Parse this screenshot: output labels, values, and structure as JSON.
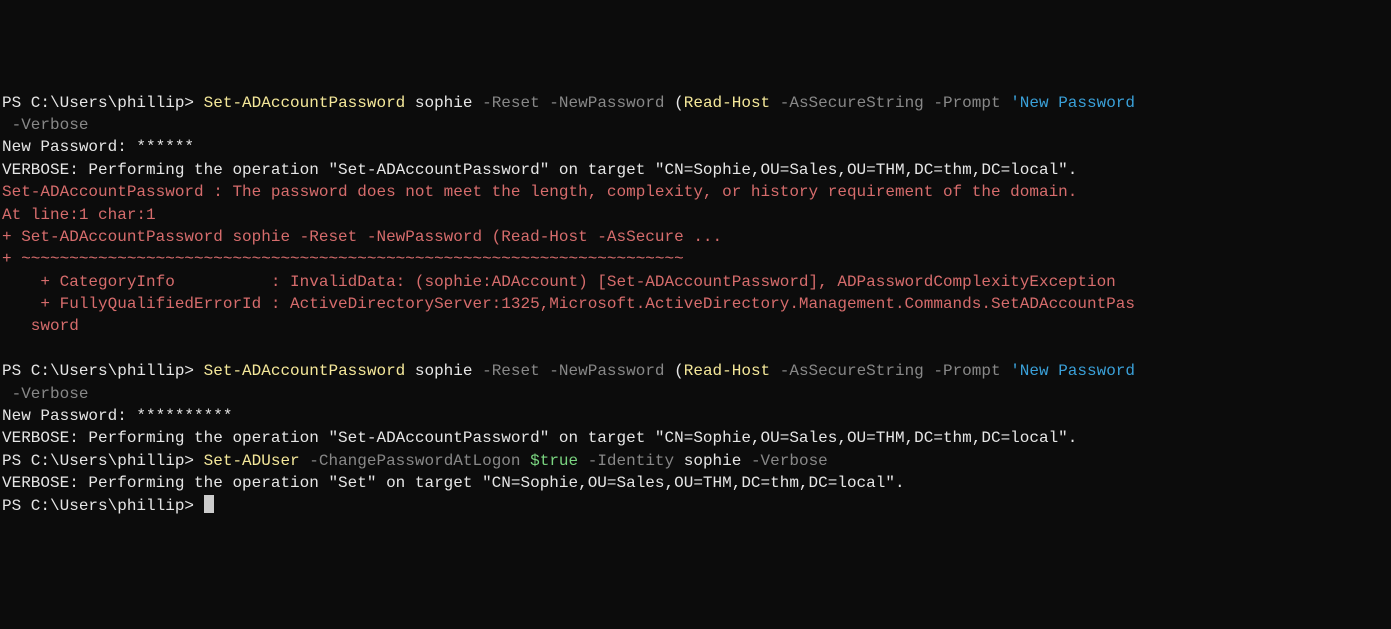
{
  "terminal": {
    "lines": [
      {
        "segments": [
          {
            "cls": "c-white",
            "text": "PS C:\\Users\\phillip> "
          },
          {
            "cls": "c-yellow",
            "text": "Set-ADAccountPassword "
          },
          {
            "cls": "c-white",
            "text": "sophie "
          },
          {
            "cls": "c-gray",
            "text": "-Reset -NewPassword "
          },
          {
            "cls": "c-white",
            "text": "("
          },
          {
            "cls": "c-yellow",
            "text": "Read-Host "
          },
          {
            "cls": "c-gray",
            "text": "-AsSecureString -Prompt "
          },
          {
            "cls": "c-cyan",
            "text": "'New Password"
          }
        ]
      },
      {
        "segments": [
          {
            "cls": "c-gray",
            "text": " -Verbose"
          }
        ]
      },
      {
        "segments": [
          {
            "cls": "c-white",
            "text": "New Password: ******"
          }
        ]
      },
      {
        "segments": [
          {
            "cls": "c-white",
            "text": "VERBOSE: Performing the operation \"Set-ADAccountPassword\" on target \"CN=Sophie,OU=Sales,OU=THM,DC=thm,DC=local\"."
          }
        ]
      },
      {
        "segments": [
          {
            "cls": "c-red",
            "text": "Set-ADAccountPassword : The password does not meet the length, complexity, or history requirement of the domain."
          }
        ]
      },
      {
        "segments": [
          {
            "cls": "c-red",
            "text": "At line:1 char:1"
          }
        ]
      },
      {
        "segments": [
          {
            "cls": "c-red",
            "text": "+ Set-ADAccountPassword sophie -Reset -NewPassword (Read-Host -AsSecure ..."
          }
        ]
      },
      {
        "segments": [
          {
            "cls": "c-red",
            "text": "+ ~~~~~~~~~~~~~~~~~~~~~~~~~~~~~~~~~~~~~~~~~~~~~~~~~~~~~~~~~~~~~~~~~~~~~"
          }
        ]
      },
      {
        "segments": [
          {
            "cls": "c-red",
            "text": "    + CategoryInfo          : InvalidData: (sophie:ADAccount) [Set-ADAccountPassword], ADPasswordComplexityException"
          }
        ]
      },
      {
        "segments": [
          {
            "cls": "c-red",
            "text": "    + FullyQualifiedErrorId : ActiveDirectoryServer:1325,Microsoft.ActiveDirectory.Management.Commands.SetADAccountPas"
          }
        ]
      },
      {
        "segments": [
          {
            "cls": "c-red",
            "text": "   sword"
          }
        ]
      },
      {
        "segments": [
          {
            "cls": "",
            "text": " "
          }
        ]
      },
      {
        "segments": [
          {
            "cls": "c-white",
            "text": "PS C:\\Users\\phillip> "
          },
          {
            "cls": "c-yellow",
            "text": "Set-ADAccountPassword "
          },
          {
            "cls": "c-white",
            "text": "sophie "
          },
          {
            "cls": "c-gray",
            "text": "-Reset -NewPassword "
          },
          {
            "cls": "c-white",
            "text": "("
          },
          {
            "cls": "c-yellow",
            "text": "Read-Host "
          },
          {
            "cls": "c-gray",
            "text": "-AsSecureString -Prompt "
          },
          {
            "cls": "c-cyan",
            "text": "'New Password"
          }
        ]
      },
      {
        "segments": [
          {
            "cls": "c-gray",
            "text": " -Verbose"
          }
        ]
      },
      {
        "segments": [
          {
            "cls": "c-white",
            "text": "New Password: **********"
          }
        ]
      },
      {
        "segments": [
          {
            "cls": "c-white",
            "text": "VERBOSE: Performing the operation \"Set-ADAccountPassword\" on target \"CN=Sophie,OU=Sales,OU=THM,DC=thm,DC=local\"."
          }
        ]
      },
      {
        "segments": [
          {
            "cls": "c-white",
            "text": "PS C:\\Users\\phillip> "
          },
          {
            "cls": "c-yellow",
            "text": "Set-ADUser "
          },
          {
            "cls": "c-gray",
            "text": "-ChangePasswordAtLogon "
          },
          {
            "cls": "c-green",
            "text": "$true "
          },
          {
            "cls": "c-gray",
            "text": "-Identity "
          },
          {
            "cls": "c-white",
            "text": "sophie "
          },
          {
            "cls": "c-gray",
            "text": "-Verbose"
          }
        ]
      },
      {
        "segments": [
          {
            "cls": "c-white",
            "text": "VERBOSE: Performing the operation \"Set\" on target \"CN=Sophie,OU=Sales,OU=THM,DC=thm,DC=local\"."
          }
        ]
      },
      {
        "segments": [
          {
            "cls": "c-white",
            "text": "PS C:\\Users\\phillip> "
          }
        ],
        "cursor": true
      }
    ]
  }
}
